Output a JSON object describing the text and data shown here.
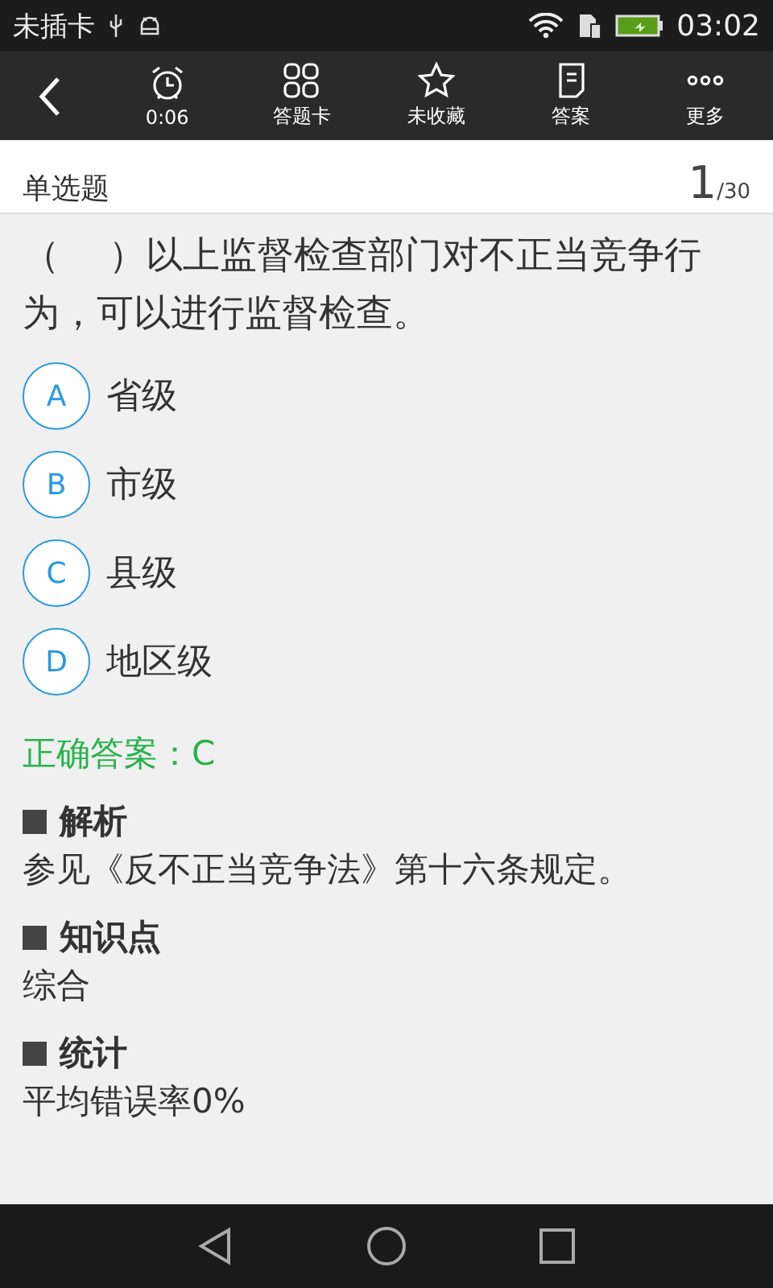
{
  "status_bar": {
    "carrier": "未插卡",
    "time": "03:02"
  },
  "toolbar": {
    "items": [
      {
        "label": "0:06"
      },
      {
        "label": "答题卡"
      },
      {
        "label": "未收藏"
      },
      {
        "label": "答案"
      },
      {
        "label": "更多"
      }
    ]
  },
  "header": {
    "type": "单选题",
    "current": "1",
    "total": "/30"
  },
  "question": "（　 ）以上监督检查部门对不正当竞争行为，可以进行监督检查。",
  "options": [
    {
      "letter": "A",
      "text": "省级"
    },
    {
      "letter": "B",
      "text": "市级"
    },
    {
      "letter": "C",
      "text": "县级"
    },
    {
      "letter": "D",
      "text": "地区级"
    }
  ],
  "correct_answer": "正确答案：C",
  "sections": [
    {
      "title": "解析",
      "body": "参见《反不正当竞争法》第十六条规定。"
    },
    {
      "title": "知识点",
      "body": "综合"
    },
    {
      "title": "统计",
      "body": "平均错误率0%"
    }
  ]
}
